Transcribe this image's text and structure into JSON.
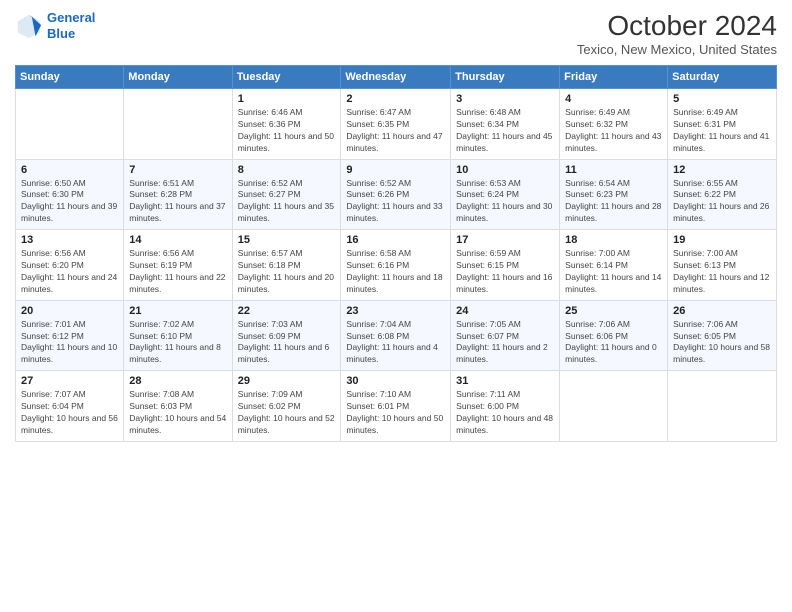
{
  "header": {
    "logo_line1": "General",
    "logo_line2": "Blue",
    "title": "October 2024",
    "subtitle": "Texico, New Mexico, United States"
  },
  "days_of_week": [
    "Sunday",
    "Monday",
    "Tuesday",
    "Wednesday",
    "Thursday",
    "Friday",
    "Saturday"
  ],
  "weeks": [
    [
      {
        "day": "",
        "info": ""
      },
      {
        "day": "",
        "info": ""
      },
      {
        "day": "1",
        "info": "Sunrise: 6:46 AM\nSunset: 6:36 PM\nDaylight: 11 hours and 50 minutes."
      },
      {
        "day": "2",
        "info": "Sunrise: 6:47 AM\nSunset: 6:35 PM\nDaylight: 11 hours and 47 minutes."
      },
      {
        "day": "3",
        "info": "Sunrise: 6:48 AM\nSunset: 6:34 PM\nDaylight: 11 hours and 45 minutes."
      },
      {
        "day": "4",
        "info": "Sunrise: 6:49 AM\nSunset: 6:32 PM\nDaylight: 11 hours and 43 minutes."
      },
      {
        "day": "5",
        "info": "Sunrise: 6:49 AM\nSunset: 6:31 PM\nDaylight: 11 hours and 41 minutes."
      }
    ],
    [
      {
        "day": "6",
        "info": "Sunrise: 6:50 AM\nSunset: 6:30 PM\nDaylight: 11 hours and 39 minutes."
      },
      {
        "day": "7",
        "info": "Sunrise: 6:51 AM\nSunset: 6:28 PM\nDaylight: 11 hours and 37 minutes."
      },
      {
        "day": "8",
        "info": "Sunrise: 6:52 AM\nSunset: 6:27 PM\nDaylight: 11 hours and 35 minutes."
      },
      {
        "day": "9",
        "info": "Sunrise: 6:52 AM\nSunset: 6:26 PM\nDaylight: 11 hours and 33 minutes."
      },
      {
        "day": "10",
        "info": "Sunrise: 6:53 AM\nSunset: 6:24 PM\nDaylight: 11 hours and 30 minutes."
      },
      {
        "day": "11",
        "info": "Sunrise: 6:54 AM\nSunset: 6:23 PM\nDaylight: 11 hours and 28 minutes."
      },
      {
        "day": "12",
        "info": "Sunrise: 6:55 AM\nSunset: 6:22 PM\nDaylight: 11 hours and 26 minutes."
      }
    ],
    [
      {
        "day": "13",
        "info": "Sunrise: 6:56 AM\nSunset: 6:20 PM\nDaylight: 11 hours and 24 minutes."
      },
      {
        "day": "14",
        "info": "Sunrise: 6:56 AM\nSunset: 6:19 PM\nDaylight: 11 hours and 22 minutes."
      },
      {
        "day": "15",
        "info": "Sunrise: 6:57 AM\nSunset: 6:18 PM\nDaylight: 11 hours and 20 minutes."
      },
      {
        "day": "16",
        "info": "Sunrise: 6:58 AM\nSunset: 6:16 PM\nDaylight: 11 hours and 18 minutes."
      },
      {
        "day": "17",
        "info": "Sunrise: 6:59 AM\nSunset: 6:15 PM\nDaylight: 11 hours and 16 minutes."
      },
      {
        "day": "18",
        "info": "Sunrise: 7:00 AM\nSunset: 6:14 PM\nDaylight: 11 hours and 14 minutes."
      },
      {
        "day": "19",
        "info": "Sunrise: 7:00 AM\nSunset: 6:13 PM\nDaylight: 11 hours and 12 minutes."
      }
    ],
    [
      {
        "day": "20",
        "info": "Sunrise: 7:01 AM\nSunset: 6:12 PM\nDaylight: 11 hours and 10 minutes."
      },
      {
        "day": "21",
        "info": "Sunrise: 7:02 AM\nSunset: 6:10 PM\nDaylight: 11 hours and 8 minutes."
      },
      {
        "day": "22",
        "info": "Sunrise: 7:03 AM\nSunset: 6:09 PM\nDaylight: 11 hours and 6 minutes."
      },
      {
        "day": "23",
        "info": "Sunrise: 7:04 AM\nSunset: 6:08 PM\nDaylight: 11 hours and 4 minutes."
      },
      {
        "day": "24",
        "info": "Sunrise: 7:05 AM\nSunset: 6:07 PM\nDaylight: 11 hours and 2 minutes."
      },
      {
        "day": "25",
        "info": "Sunrise: 7:06 AM\nSunset: 6:06 PM\nDaylight: 11 hours and 0 minutes."
      },
      {
        "day": "26",
        "info": "Sunrise: 7:06 AM\nSunset: 6:05 PM\nDaylight: 10 hours and 58 minutes."
      }
    ],
    [
      {
        "day": "27",
        "info": "Sunrise: 7:07 AM\nSunset: 6:04 PM\nDaylight: 10 hours and 56 minutes."
      },
      {
        "day": "28",
        "info": "Sunrise: 7:08 AM\nSunset: 6:03 PM\nDaylight: 10 hours and 54 minutes."
      },
      {
        "day": "29",
        "info": "Sunrise: 7:09 AM\nSunset: 6:02 PM\nDaylight: 10 hours and 52 minutes."
      },
      {
        "day": "30",
        "info": "Sunrise: 7:10 AM\nSunset: 6:01 PM\nDaylight: 10 hours and 50 minutes."
      },
      {
        "day": "31",
        "info": "Sunrise: 7:11 AM\nSunset: 6:00 PM\nDaylight: 10 hours and 48 minutes."
      },
      {
        "day": "",
        "info": ""
      },
      {
        "day": "",
        "info": ""
      }
    ]
  ]
}
